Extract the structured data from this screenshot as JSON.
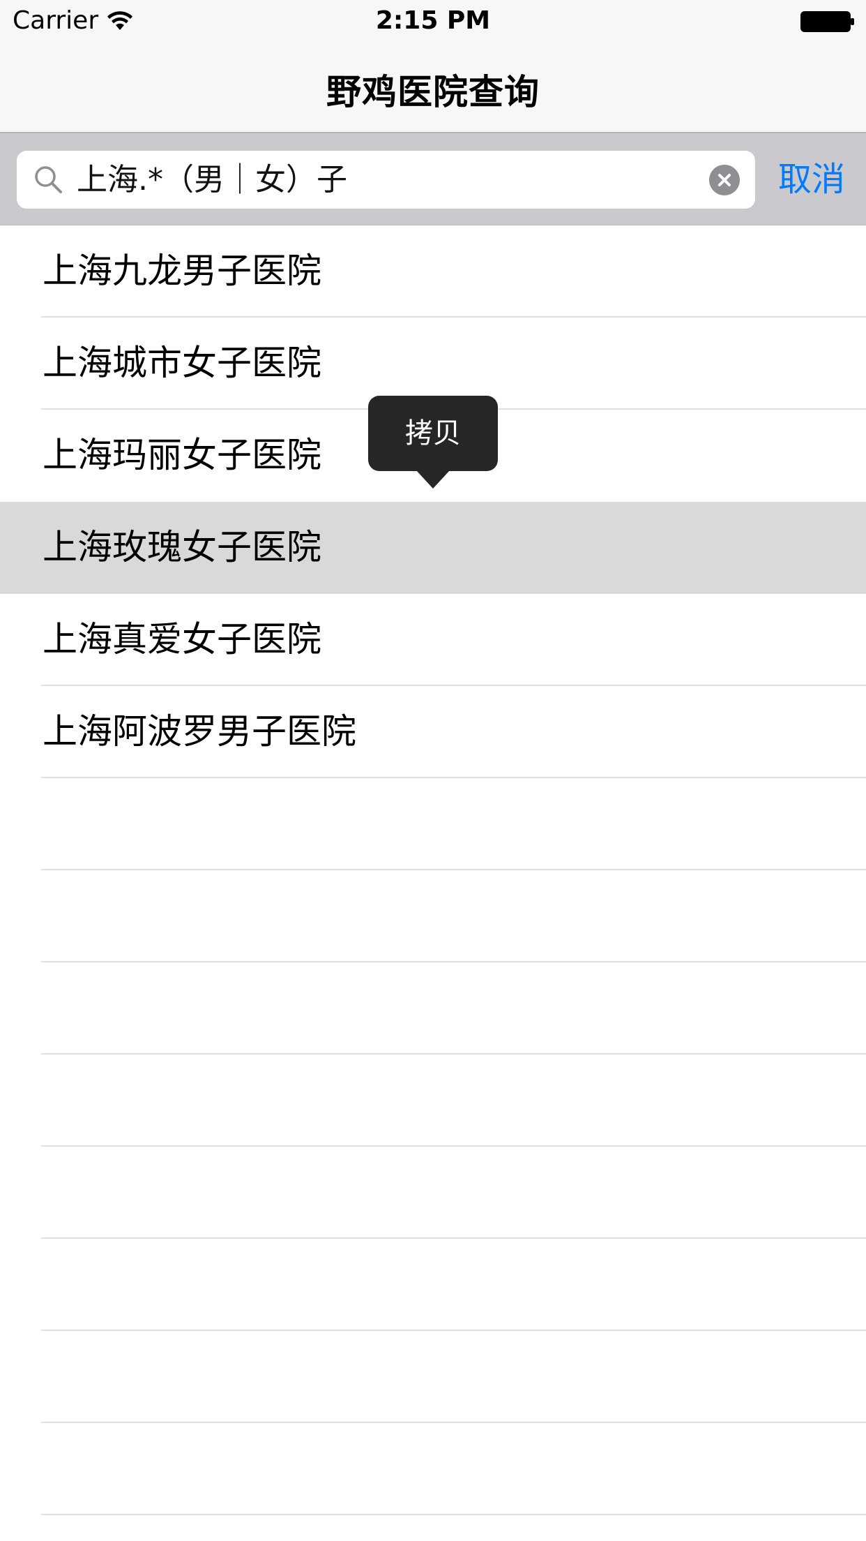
{
  "status_bar": {
    "carrier": "Carrier",
    "time": "2:15 PM"
  },
  "nav": {
    "title": "野鸡医院查询"
  },
  "search": {
    "query": "上海.*（男｜女）子",
    "cancel_label": "取消",
    "search_icon": "search-icon",
    "clear_icon": "clear-circle-icon"
  },
  "results": [
    {
      "label": "上海九龙男子医院"
    },
    {
      "label": "上海城市女子医院"
    },
    {
      "label": "上海玛丽女子医院"
    },
    {
      "label": "上海玫瑰女子医院",
      "selected": true
    },
    {
      "label": "上海真爱女子医院"
    },
    {
      "label": "上海阿波罗男子医院"
    },
    {
      "label": ""
    },
    {
      "label": ""
    },
    {
      "label": ""
    },
    {
      "label": ""
    },
    {
      "label": ""
    },
    {
      "label": ""
    },
    {
      "label": ""
    },
    {
      "label": ""
    }
  ],
  "menu": {
    "copy_label": "拷贝"
  },
  "colors": {
    "accent": "#007aff",
    "selected_row": "#d9d9d9",
    "search_bar_bg": "#c9c9ce",
    "callout_bg": "#262626"
  }
}
